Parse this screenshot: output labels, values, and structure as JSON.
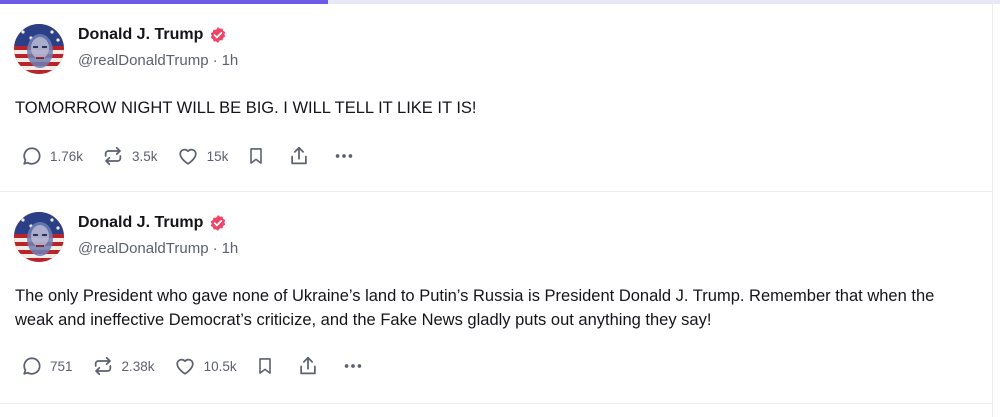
{
  "progress": {
    "fraction": 0.328,
    "color": "#6b5be7"
  },
  "colors": {
    "verified": "#ee4466",
    "muted": "#5b6170",
    "text": "#14151a"
  },
  "posts": [
    {
      "author": {
        "name": "Donald J. Trump",
        "handle": "@realDonaldTrump",
        "time": "1h",
        "separator": "·"
      },
      "text": "TOMORROW NIGHT WILL BE BIG. I WILL TELL IT LIKE IT IS!",
      "stats": {
        "replies": "1.76k",
        "reposts": "3.5k",
        "likes": "15k"
      }
    },
    {
      "author": {
        "name": "Donald J. Trump",
        "handle": "@realDonaldTrump",
        "time": "1h",
        "separator": "·"
      },
      "text": "The only President who gave none of Ukraine’s land to Putin’s Russia is President Donald J. Trump. Remember that when the weak and ineffective Democrat’s criticize, and the Fake News gladly puts out anything they say!",
      "stats": {
        "replies": "751",
        "reposts": "2.38k",
        "likes": "10.5k"
      }
    }
  ],
  "icons": {
    "reply": "reply-icon",
    "repost": "repost-icon",
    "like": "heart-icon",
    "bookmark": "bookmark-icon",
    "share": "share-icon",
    "more": "more-icon",
    "verified": "verified-badge-icon"
  }
}
